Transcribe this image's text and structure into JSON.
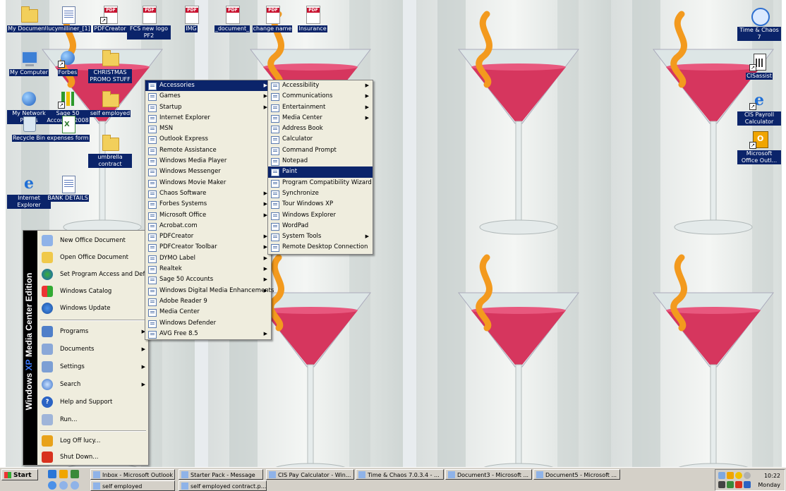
{
  "desktop_icons": [
    {
      "id": "my-documents",
      "label": "My Documents",
      "icon": "folder-docs-icon"
    },
    {
      "id": "lucymilliner",
      "label": "lucymilliner_[1]",
      "icon": "word-doc-icon"
    },
    {
      "id": "pdfcreator",
      "label": "PDFCreator",
      "icon": "pdfcreator-icon"
    },
    {
      "id": "fcs-new-logo",
      "label": "FCS new logo PF2",
      "icon": "pdf-icon"
    },
    {
      "id": "img",
      "label": "IMG",
      "icon": "pdf-icon"
    },
    {
      "id": "document",
      "label": "_document_",
      "icon": "pdf-icon"
    },
    {
      "id": "change-name",
      "label": "change name",
      "icon": "pdf-icon"
    },
    {
      "id": "insurance",
      "label": "Insurance",
      "icon": "pdf-icon"
    },
    {
      "id": "my-computer",
      "label": "My Computer",
      "icon": "computer-icon"
    },
    {
      "id": "forbes",
      "label": "Forbes",
      "icon": "globe-icon"
    },
    {
      "id": "christmas",
      "label": "CHRISTMAS PROMO STUFF",
      "icon": "folder-icon"
    },
    {
      "id": "my-network",
      "label": "My Network Places",
      "icon": "network-icon"
    },
    {
      "id": "sage50",
      "label": "Sage 50 Accounts 2008",
      "icon": "sage-icon"
    },
    {
      "id": "self-employed",
      "label": "self employed",
      "icon": "folder-icon"
    },
    {
      "id": "recycle-bin",
      "label": "Recycle Bin",
      "icon": "recycle-bin-icon"
    },
    {
      "id": "expenses-form",
      "label": "expenses form",
      "icon": "excel-icon"
    },
    {
      "id": "umbrella",
      "label": "umbrella contract",
      "icon": "folder-icon"
    },
    {
      "id": "internet-explorer",
      "label": "Internet Explorer",
      "icon": "internet-explorer-icon"
    },
    {
      "id": "bank-details",
      "label": "BANK DETAILS",
      "icon": "word-doc-icon"
    },
    {
      "id": "time-chaos",
      "label": "Time & Chaos 7",
      "icon": "clock-icon"
    },
    {
      "id": "cisassist",
      "label": "CISassist",
      "icon": "calculator-icon"
    },
    {
      "id": "cis-payroll",
      "label": "CIS Payroll Calculator",
      "icon": "internet-explorer-icon"
    },
    {
      "id": "ms-office-outlook",
      "label": "Microsoft Office Outl...",
      "icon": "outlook-icon"
    }
  ],
  "start_menu": {
    "band_prefix": "Windows",
    "band_accent": "XP",
    "band_suffix": "Media Center Edition",
    "top_items": [
      {
        "label": "New Office Document",
        "icon": "new-office-doc-icon"
      },
      {
        "label": "Open Office Document",
        "icon": "open-office-doc-icon"
      },
      {
        "label": "Set Program Access and Defaults",
        "icon": "program-access-icon"
      },
      {
        "label": "Windows Catalog",
        "icon": "windows-catalog-icon"
      },
      {
        "label": "Windows Update",
        "icon": "windows-update-icon"
      }
    ],
    "main_items": [
      {
        "label": "Programs",
        "icon": "programs-icon",
        "submenu": true
      },
      {
        "label": "Documents",
        "icon": "documents-icon",
        "submenu": true
      },
      {
        "label": "Settings",
        "icon": "settings-icon",
        "submenu": true
      },
      {
        "label": "Search",
        "icon": "search-icon",
        "submenu": true
      },
      {
        "label": "Help and Support",
        "icon": "help-icon",
        "submenu": false
      },
      {
        "label": "Run...",
        "icon": "run-icon",
        "submenu": false
      }
    ],
    "bottom_items": [
      {
        "label": "Log Off lucy...",
        "icon": "log-off-icon"
      },
      {
        "label": "Shut Down...",
        "icon": "shut-down-icon"
      }
    ]
  },
  "programs_menu": [
    {
      "label": "Accessories",
      "submenu": true,
      "selected": true
    },
    {
      "label": "Games",
      "submenu": true
    },
    {
      "label": "Startup",
      "submenu": true
    },
    {
      "label": "Internet Explorer",
      "submenu": false
    },
    {
      "label": "MSN",
      "submenu": false
    },
    {
      "label": "Outlook Express",
      "submenu": false
    },
    {
      "label": "Remote Assistance",
      "submenu": false
    },
    {
      "label": "Windows Media Player",
      "submenu": false
    },
    {
      "label": "Windows Messenger",
      "submenu": false
    },
    {
      "label": "Windows Movie Maker",
      "submenu": false
    },
    {
      "label": "Chaos Software",
      "submenu": true
    },
    {
      "label": "Forbes Systems",
      "submenu": true
    },
    {
      "label": "Microsoft Office",
      "submenu": true
    },
    {
      "label": "Acrobat.com",
      "submenu": false
    },
    {
      "label": "PDFCreator",
      "submenu": true
    },
    {
      "label": "PDFCreator Toolbar",
      "submenu": true
    },
    {
      "label": "DYMO Label",
      "submenu": true
    },
    {
      "label": "Realtek",
      "submenu": true
    },
    {
      "label": "Sage 50 Accounts",
      "submenu": true
    },
    {
      "label": "Windows Digital Media Enhancements",
      "submenu": true
    },
    {
      "label": "Adobe Reader 9",
      "submenu": false
    },
    {
      "label": "Media Center",
      "submenu": false
    },
    {
      "label": "Windows Defender",
      "submenu": false
    },
    {
      "label": "AVG Free 8.5",
      "submenu": true
    }
  ],
  "accessories_menu": [
    {
      "label": "Accessibility",
      "submenu": true
    },
    {
      "label": "Communications",
      "submenu": true
    },
    {
      "label": "Entertainment",
      "submenu": true
    },
    {
      "label": "Media Center",
      "submenu": true
    },
    {
      "label": "Address Book",
      "submenu": false
    },
    {
      "label": "Calculator",
      "submenu": false
    },
    {
      "label": "Command Prompt",
      "submenu": false
    },
    {
      "label": "Notepad",
      "submenu": false
    },
    {
      "label": "Paint",
      "submenu": false,
      "selected": true
    },
    {
      "label": "Program Compatibility Wizard",
      "submenu": false
    },
    {
      "label": "Synchronize",
      "submenu": false
    },
    {
      "label": "Tour Windows XP",
      "submenu": false
    },
    {
      "label": "Windows Explorer",
      "submenu": false
    },
    {
      "label": "WordPad",
      "submenu": false
    },
    {
      "label": "System Tools",
      "submenu": true
    },
    {
      "label": "Remote Desktop Connection",
      "submenu": false
    }
  ],
  "taskbar": {
    "start_label": "Start",
    "windows": [
      {
        "label": "Inbox - Microsoft Outlook",
        "icon": "outlook-icon"
      },
      {
        "label": "Starter Pack - Message",
        "icon": "message-icon"
      },
      {
        "label": "CIS Pay Calculator - Win...",
        "icon": "internet-explorer-icon"
      },
      {
        "label": "Time & Chaos 7.0.3.4 - ...",
        "icon": "clock-icon"
      },
      {
        "label": "Document3 - Microsoft ...",
        "icon": "word-icon"
      },
      {
        "label": "Document5 - Microsoft ...",
        "icon": "word-icon"
      },
      {
        "label": "self employed",
        "icon": "folder-icon"
      },
      {
        "label": "self employed contract.p...",
        "icon": "pdf-icon"
      }
    ],
    "clock_time": "10:22",
    "clock_day": "Monday"
  }
}
